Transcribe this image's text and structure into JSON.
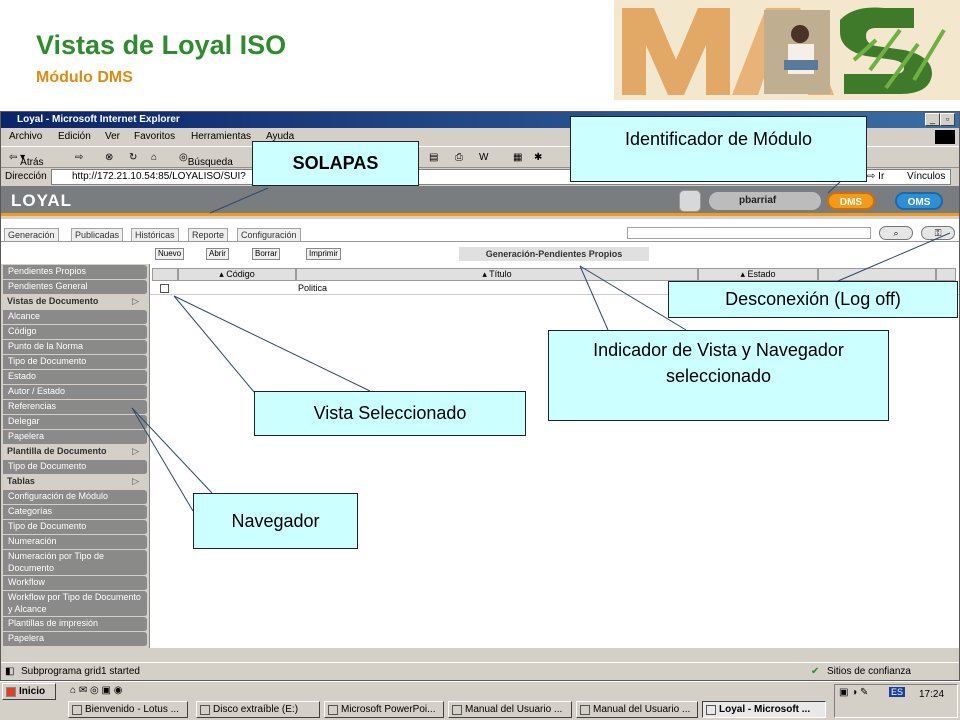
{
  "slide": {
    "title": "Vistas de Loyal ISO",
    "subtitle": "Módulo DMS"
  },
  "window": {
    "title": "Loyal - Microsoft Internet Explorer",
    "menu": [
      "Archivo",
      "Edición",
      "Ver",
      "Favoritos",
      "Herramientas",
      "Ayuda"
    ],
    "toolbar": {
      "back": "Atrás",
      "search": "Búsqueda",
      "go": "Ir",
      "links": "Vínculos"
    },
    "address_label": "Dirección",
    "address": "http://172.21.10.54:85/LOYALISO/SUI?"
  },
  "app": {
    "logo": "LOYAL",
    "user": "pbarriaf",
    "module_dms": "DMS",
    "module_oms": "OMS",
    "tabs": [
      "Generación",
      "Publicadas",
      "Históricas",
      "Reporte",
      "Configuración"
    ],
    "actions": [
      "Nuevo",
      "Abrir",
      "Borrar",
      "Imprimir"
    ],
    "view_title": "Generación-Pendientes Propios",
    "columns": [
      "Código",
      "Título",
      "Estado"
    ],
    "rows": [
      {
        "codigo": "",
        "titulo": "Politica"
      }
    ],
    "nav": [
      {
        "label": "Pendientes Propios",
        "type": "item"
      },
      {
        "label": "Pendientes General",
        "type": "item"
      },
      {
        "label": "Vistas de Documento",
        "type": "header"
      },
      {
        "label": "Alcance",
        "type": "item"
      },
      {
        "label": "Código",
        "type": "item"
      },
      {
        "label": "Punto de la Norma",
        "type": "item"
      },
      {
        "label": "Tipo de Documento",
        "type": "item"
      },
      {
        "label": "Estado",
        "type": "item"
      },
      {
        "label": "Autor / Estado",
        "type": "item"
      },
      {
        "label": "Referencias",
        "type": "item"
      },
      {
        "label": "Delegar",
        "type": "item"
      },
      {
        "label": "Papelera",
        "type": "item"
      },
      {
        "label": "Plantilla de Documento",
        "type": "header"
      },
      {
        "label": "Tipo de Documento",
        "type": "item"
      },
      {
        "label": "Tablas",
        "type": "header"
      },
      {
        "label": "Configuración de Módulo",
        "type": "item"
      },
      {
        "label": "Categorías",
        "type": "item"
      },
      {
        "label": "Tipo de Documento",
        "type": "item"
      },
      {
        "label": "Numeración",
        "type": "item"
      },
      {
        "label": "Numeración por Tipo de Documento",
        "type": "item2"
      },
      {
        "label": "Workflow",
        "type": "item"
      },
      {
        "label": "Workflow por Tipo de Documento y Alcance",
        "type": "item2"
      },
      {
        "label": "Plantillas de impresión",
        "type": "item"
      },
      {
        "label": "Papelera",
        "type": "item"
      }
    ]
  },
  "status": {
    "text": "Subprograma grid1 started",
    "zone": "Sitios de confianza"
  },
  "taskbar": {
    "start": "Inicio",
    "lang": "ES",
    "clock": "17:24",
    "tasks": [
      "Bienvenido - Lotus ...",
      "Disco extraíble (E:)",
      "Microsoft PowerPoi...",
      "Manual del Usuario ...",
      "Manual del Usuario ...",
      "Loyal - Microsoft ..."
    ]
  },
  "callouts": {
    "solapas": "SOLAPAS",
    "module_id": "Identificador de Módulo",
    "logoff": "Desconexión (Log off)",
    "view_indicator": "Indicador de Vista y Navegador seleccionado",
    "view_selected": "Vista Seleccionado",
    "navigator": "Navegador"
  },
  "colors": {
    "title_green": "#2e8b2e",
    "subtitle_orange": "#e08a10",
    "callout_fill": "#ccffff",
    "dms_orange": "#f39a1a",
    "oms_blue": "#2f8fd6"
  }
}
